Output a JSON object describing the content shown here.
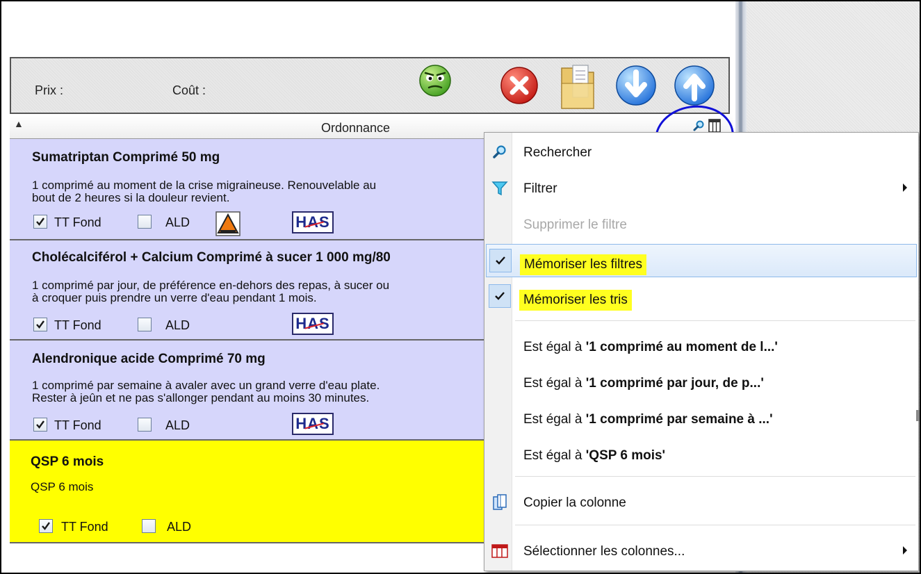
{
  "toolbar": {
    "price_label": "Prix :",
    "cost_label": "Coût :",
    "icons": [
      "smiley-face-icon",
      "delete-red-x-icon",
      "document-folder-icon",
      "arrow-down-icon",
      "arrow-up-icon"
    ]
  },
  "column_header": {
    "title": "Ordonnance"
  },
  "rows": [
    {
      "title": "Sumatriptan Comprimé 50 mg",
      "description": "1 comprimé au moment de la crise migraineuse. Renouvelable au\nbout de 2 heures si la douleur revient.",
      "tt_fond_label": "TT Fond",
      "tt_fond_checked": true,
      "ald_label": "ALD",
      "ald_checked": false,
      "has_warning": true,
      "has_logo": "HAS"
    },
    {
      "title": "Cholécalciférol + Calcium Comprimé à sucer 1 000 mg/80",
      "description": "1 comprimé par jour, de préférence en-dehors des repas, à sucer ou\nà croquer puis prendre un verre d'eau pendant 1 mois.",
      "tt_fond_label": "TT Fond",
      "tt_fond_checked": true,
      "ald_label": "ALD",
      "ald_checked": false,
      "has_logo": "HAS"
    },
    {
      "title": "Alendronique acide Comprimé 70 mg",
      "description": "1 comprimé par semaine à avaler avec un grand verre d'eau plate.\nRester à jeûn et ne pas s'allonger pendant au moins 30 minutes.",
      "tt_fond_label": "TT Fond",
      "tt_fond_checked": true,
      "ald_label": "ALD",
      "ald_checked": false,
      "has_logo": "HAS"
    },
    {
      "title": "QSP 6 mois",
      "description": "QSP 6 mois",
      "tt_fond_label": "TT Fond",
      "tt_fond_checked": true,
      "ald_label": "ALD",
      "ald_checked": false
    }
  ],
  "context_menu": {
    "search": "Rechercher",
    "filter": "Filtrer",
    "remove_filter": "Supprimer le filtre",
    "remember_filters": "Mémoriser les filtres",
    "remember_filters_checked": true,
    "remember_sorts": "Mémoriser les tris",
    "remember_sorts_checked": true,
    "equals_prefix": "Est égal à",
    "equals_items": [
      "'1 comprimé au moment de l...'",
      "'1 comprimé par jour, de p...'",
      "'1 comprimé par semaine à ...'",
      "'QSP 6 mois'"
    ],
    "copy_column": "Copier la colonne",
    "select_columns": "Sélectionner les colonnes...",
    "highlight_color": "#ffff20"
  },
  "colors": {
    "row_background": "#d6d6fb",
    "row_highlight": "#ffff00",
    "annotation_circle": "#1010d8"
  }
}
